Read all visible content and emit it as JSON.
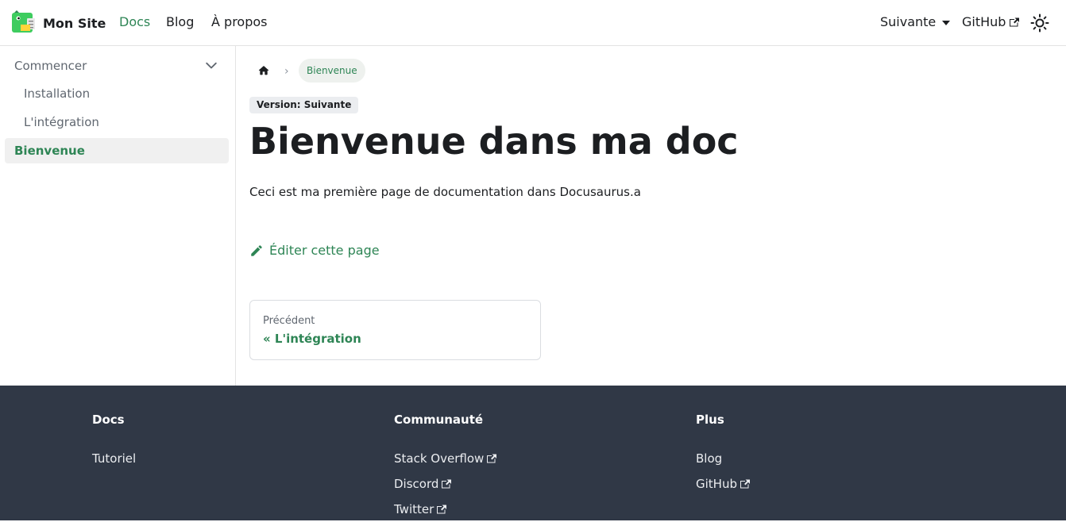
{
  "navbar": {
    "site_title": "Mon Site",
    "links": {
      "docs": "Docs",
      "blog": "Blog",
      "about": "À propos"
    },
    "version_dropdown": "Suivante",
    "github": "GitHub",
    "theme_icon": "sun-icon",
    "accent_color": "#2e8555"
  },
  "sidebar": {
    "category": "Commencer",
    "items": {
      "installation": "Installation",
      "integration": "L'intégration"
    },
    "active": "Bienvenue"
  },
  "breadcrumb": {
    "current": "Bienvenue"
  },
  "doc": {
    "version_badge": "Version: Suivante",
    "title": "Bienvenue dans ma doc",
    "body": "Ceci est ma première page de documentation dans Docusaurus.a",
    "edit_link": "Éditer cette page"
  },
  "pagination": {
    "previous_sublabel": "Précédent",
    "previous_label": "« L'intégration"
  },
  "footer": {
    "background": "#303846",
    "columns": {
      "docs": {
        "title": "Docs",
        "links": [
          "Tutoriel"
        ]
      },
      "community": {
        "title": "Communauté",
        "links": [
          "Stack Overflow",
          "Discord",
          "Twitter"
        ]
      },
      "more": {
        "title": "Plus",
        "links": [
          "Blog",
          "GitHub"
        ]
      }
    }
  }
}
